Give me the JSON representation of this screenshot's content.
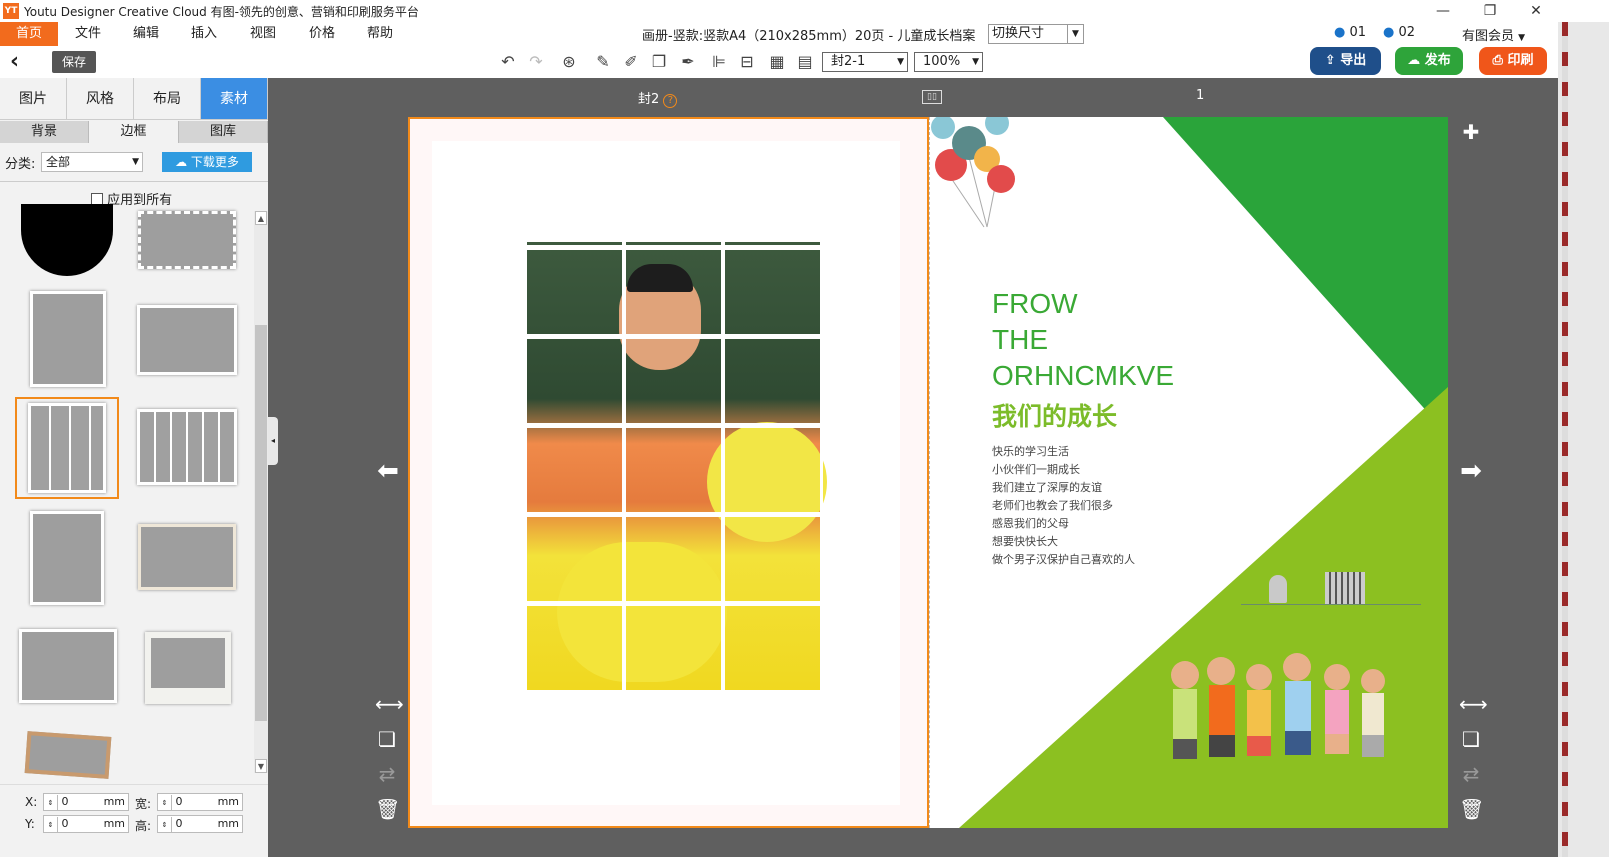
{
  "window": {
    "title": "Youtu Designer Creative Cloud 有图-领先的创意、营销和印刷服务平台",
    "logo_text": "YT",
    "min": "—",
    "restore": "❐",
    "close": "✕"
  },
  "menu": [
    "首页",
    "文件",
    "编辑",
    "插入",
    "视图",
    "价格",
    "帮助"
  ],
  "doc_title": "画册-竖款:竖款A4（210x285mm）20页 - 儿童成长档案",
  "size_switch": "切换尺寸",
  "users": {
    "u1": "01",
    "u2": "02",
    "member": "有图会员"
  },
  "toolbar": {
    "back": "‹",
    "save": "保存",
    "page_select": "封2-1",
    "zoom": "100%"
  },
  "actions": {
    "export": "导出",
    "publish": "发布",
    "print": "印刷"
  },
  "left": {
    "tabs": [
      "图片",
      "风格",
      "布局",
      "素材"
    ],
    "subtabs": [
      "背景",
      "边框",
      "图库"
    ],
    "category_label": "分类:",
    "category_value": "全部",
    "download_more": "下载更多",
    "apply_all": "应用到所有",
    "x_label": "X:",
    "y_label": "Y:",
    "w_label": "宽:",
    "h_label": "高:",
    "zero": "0",
    "unit": "mm"
  },
  "canvas": {
    "left_page_label": "封2",
    "right_page_label": "1",
    "help": "?"
  },
  "page": {
    "title_lines": [
      "FROW",
      "THE",
      "ORHNCMKVE"
    ],
    "subtitle": "我们的成长",
    "text_lines": [
      "快乐的学习生活",
      "小伙伴们一期成长",
      "我们建立了深厚的友谊",
      "老师们也教会了我们很多",
      "感恩我们的父母",
      "想要快快长大",
      "做个男子汉保护自己喜欢的人"
    ]
  },
  "colors": {
    "accent": "#f26b1d",
    "blue": "#3b8ee3",
    "green_dark": "#2aa43a",
    "green_light": "#8cc021",
    "title_green": "#3aa935",
    "export": "#1f4f8a",
    "publish": "#2ea43a",
    "print": "#f0561a"
  }
}
